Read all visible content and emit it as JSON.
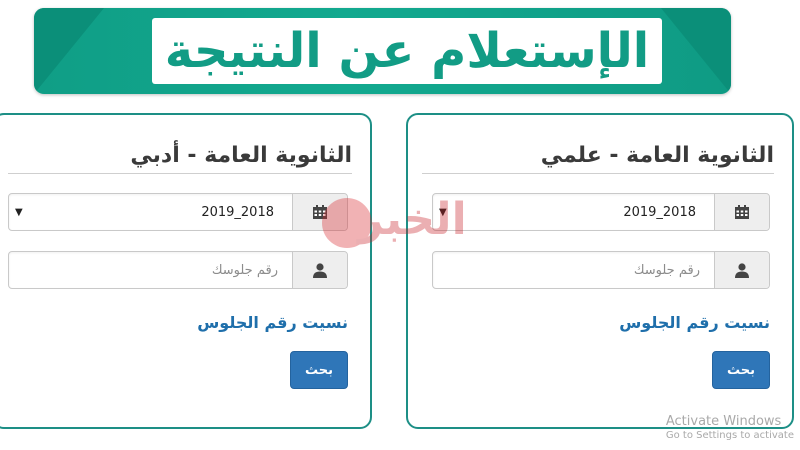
{
  "banner": {
    "title": "الإستعلام عن النتيجة"
  },
  "cards": {
    "science": {
      "title": "الثانوية العامة - علمي",
      "year": "2019_2018",
      "seat_placeholder": "رقم جلوسك",
      "forgot_link": "نسيت رقم الجلوس",
      "search_button": "بحث"
    },
    "literary": {
      "title": "الثانوية العامة - أدبي",
      "year": "2019_2018",
      "seat_placeholder": "رقم جلوسك",
      "forgot_link": "نسيت رقم الجلوس",
      "search_button": "بحث"
    }
  },
  "watermark": {
    "text": "الخبر"
  },
  "activation": {
    "line1": "Activate Windows",
    "line2": "Go to Settings to activate"
  },
  "icons": {
    "calendar": "calendar-icon",
    "user": "user-icon",
    "dropdown": "caret-down-icon"
  },
  "colors": {
    "banner": "#12a98f",
    "card_border": "#1d8f86",
    "link": "#1f6fab",
    "button": "#2f76b8"
  }
}
